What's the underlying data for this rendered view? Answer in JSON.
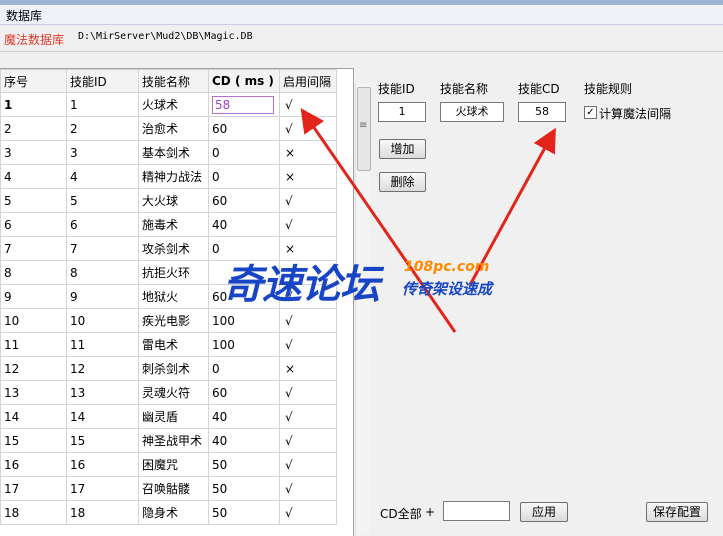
{
  "window": {
    "title": "数据库"
  },
  "path_bar": {
    "db_name": "魔法数据库",
    "file_path": "D:\\MirServer\\Mud2\\DB\\Magic.DB"
  },
  "table": {
    "columns": [
      "序号",
      "技能ID",
      "技能名称",
      "CD ( ms )",
      "启用间隔"
    ],
    "rows": [
      [
        "1",
        "1",
        "火球术",
        "58",
        "√"
      ],
      [
        "2",
        "2",
        "治愈术",
        "60",
        "√"
      ],
      [
        "3",
        "3",
        "基本剑术",
        "0",
        "×"
      ],
      [
        "4",
        "4",
        "精神力战法",
        "0",
        "×"
      ],
      [
        "5",
        "5",
        "大火球",
        "60",
        "√"
      ],
      [
        "6",
        "6",
        "施毒术",
        "40",
        "√"
      ],
      [
        "7",
        "7",
        "攻杀剑术",
        "0",
        "×"
      ],
      [
        "8",
        "8",
        "抗拒火环",
        "",
        ""
      ],
      [
        "9",
        "9",
        "地狱火",
        "60",
        "√"
      ],
      [
        "10",
        "10",
        "疾光电影",
        "100",
        "√"
      ],
      [
        "11",
        "11",
        "雷电术",
        "100",
        "√"
      ],
      [
        "12",
        "12",
        "刺杀剑术",
        "0",
        "×"
      ],
      [
        "13",
        "13",
        "灵魂火符",
        "60",
        "√"
      ],
      [
        "14",
        "14",
        "幽灵盾",
        "40",
        "√"
      ],
      [
        "15",
        "15",
        "神圣战甲术",
        "40",
        "√"
      ],
      [
        "16",
        "16",
        "困魔咒",
        "50",
        "√"
      ],
      [
        "17",
        "17",
        "召唤骷髅",
        "50",
        "√"
      ],
      [
        "18",
        "18",
        "隐身术",
        "50",
        "√"
      ]
    ]
  },
  "editor": {
    "id_label": "技能ID",
    "name_label": "技能名称",
    "cd_label": "技能CD",
    "rule_label": "技能规则",
    "id_value": "1",
    "name_value": "火球术",
    "cd_value": "58",
    "calc_interval_label": "计算魔法间隔",
    "calc_interval_mark": "✓",
    "add_button": "增加",
    "delete_button": "删除"
  },
  "footer": {
    "cd_all_label": "CD全部",
    "plus": "+",
    "cd_all_value": "",
    "apply_button": "应用",
    "save_button": "保存配置"
  },
  "scrollbar": {
    "grip": "≡"
  },
  "watermark": {
    "main": "奇速论坛",
    "url": "108pc.com",
    "sub": "传奇架设速成"
  },
  "colors": {
    "db_name": "#e03a2a",
    "arrow": "#e3241b",
    "watermark_blue": "#1745c6",
    "watermark_orange": "#ff8a00",
    "selected_cd": "#9b45c8"
  }
}
